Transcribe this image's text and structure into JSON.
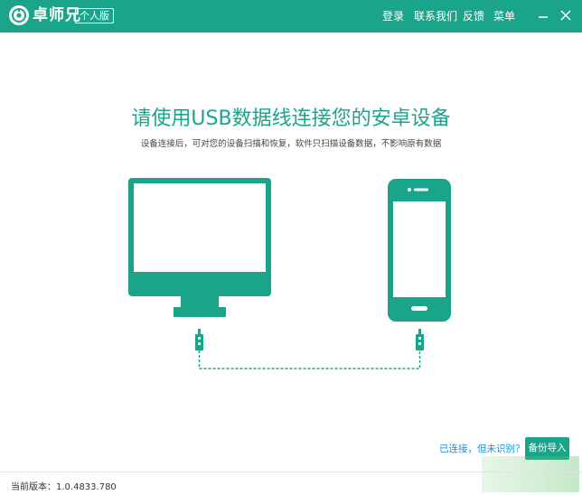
{
  "titlebar": {
    "app_name": "卓师兄",
    "edition": "个人版",
    "nav": {
      "login": "登录",
      "contact": "联系我们",
      "feedback": "反馈",
      "menu": "菜单"
    }
  },
  "main": {
    "headline": "请使用USB数据线连接您的安卓设备",
    "subline": "设备连接后，可对您的设备扫描和恢复，软件只扫描设备数据，不影响原有数据"
  },
  "connection": {
    "status_link": "已连接，但未识别？",
    "import_button": "备份导入"
  },
  "footer": {
    "version": "当前版本：1.0.4833.780"
  },
  "colors": {
    "brand": "#1aa58a",
    "link": "#1a8fd0"
  }
}
